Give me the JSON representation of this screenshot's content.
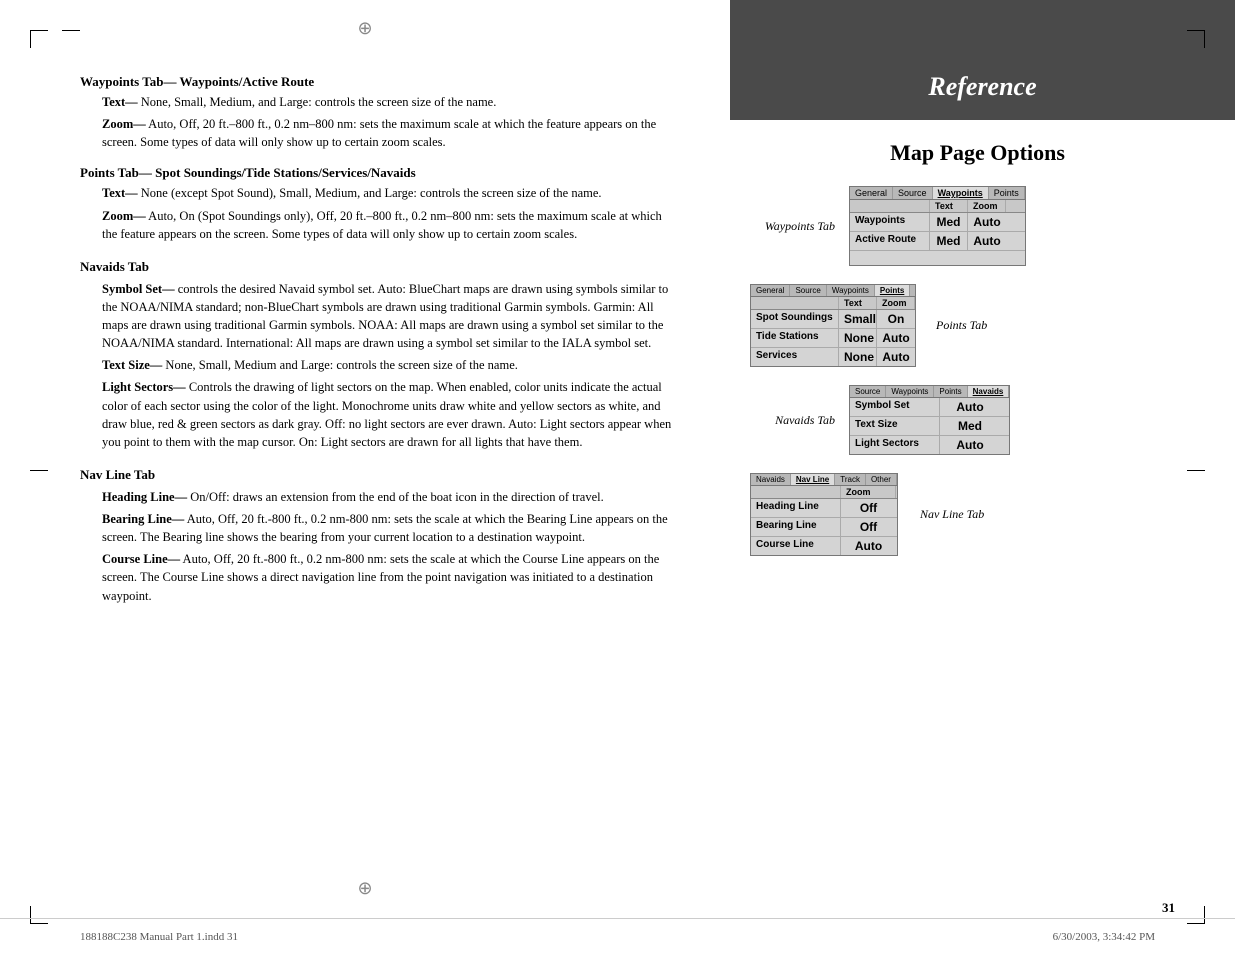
{
  "page": {
    "number": "31",
    "bottom_left": "188188C238 Manual Part 1.indd  31",
    "bottom_right": "6/30/2003, 3:34:42 PM"
  },
  "reference": {
    "header": "Reference",
    "section_title": "Map Page Options"
  },
  "left": {
    "sections": [
      {
        "id": "waypoints-tab",
        "heading_bold": "Waypoints Tab—",
        "heading_rest": " Waypoints/Active Route",
        "items": [
          {
            "label_bold": "Text—",
            "text": " None, Small, Medium, and Large: controls the screen size of the name."
          },
          {
            "label_bold": "Zoom—",
            "text": " Auto, Off, 20 ft.–800 ft., 0.2 nm–800 nm: sets the maximum scale at which the feature appears on the screen. Some types of data will only show up to certain zoom scales."
          }
        ]
      },
      {
        "id": "points-tab",
        "heading_bold": "Points Tab—",
        "heading_rest": " Spot Soundings/Tide Stations/Services/Navaids",
        "items": [
          {
            "label_bold": "Text—",
            "text": " None (except Spot Sound), Small, Medium, and Large: controls the screen size of the name."
          },
          {
            "label_bold": "Zoom—",
            "text": " Auto, On (Spot Soundings only), Off, 20 ft.–800 ft., 0.2 nm–800 nm: sets the maximum scale at which the feature appears on the screen. Some types of data will only show up to certain zoom scales."
          }
        ]
      },
      {
        "id": "navaids-tab",
        "heading": "Navaids Tab",
        "items": [
          {
            "label_bold": "Symbol Set—",
            "text": " controls the desired Navaid symbol set. Auto: BlueChart maps are drawn using symbols similar to the NOAA/NIMA standard; non-BlueChart symbols are drawn using traditional Garmin symbols. Garmin: All maps are drawn using traditional Garmin symbols. NOAA: All maps are drawn using a symbol set similar to the NOAA/NIMA standard. International: All maps are drawn using a symbol set similar to the IALA symbol set."
          },
          {
            "label_bold": "Text Size—",
            "text": " None, Small, Medium and Large: controls the screen size of the name."
          },
          {
            "label_bold": "Light Sectors—",
            "text": " Controls the drawing of light sectors on the map. When enabled, color units indicate the actual color of each sector using the color of the light. Monochrome units draw white and yellow sectors as white, and draw blue, red & green sectors as dark gray. Off: no light sectors are ever drawn. Auto: Light sectors appear when you point to them with the map cursor. On: Light sectors are drawn for all lights that have them."
          }
        ]
      },
      {
        "id": "nav-line-tab",
        "heading": "Nav Line Tab",
        "items": [
          {
            "label_bold": "Heading Line—",
            "text": " On/Off: draws an extension from the end of the boat icon in the direction of travel."
          },
          {
            "label_bold": "Bearing Line—",
            "text": " Auto, Off, 20 ft.-800 ft., 0.2 nm-800 nm: sets the scale at which the Bearing Line appears on the screen. The Bearing line shows the bearing from your current location to a destination waypoint."
          },
          {
            "label_bold": "Course Line—",
            "text": " Auto, Off, 20 ft.-800 ft., 0.2 nm-800 nm: sets the scale at which the Course Line appears on the screen. The Course Line shows a direct navigation line from the point navigation was initiated to a destination waypoint."
          }
        ]
      }
    ]
  },
  "right": {
    "waypoints_tab": {
      "label": "Waypoints Tab",
      "tabs": [
        "General",
        "Source",
        "Waypoints",
        "Points"
      ],
      "active_tab": "Waypoints",
      "col_headers": [
        "",
        "Text",
        "Zoom"
      ],
      "rows": [
        {
          "name": "Waypoints",
          "text": "Med",
          "zoom": "Auto"
        },
        {
          "name": "Active Route",
          "text": "Med",
          "zoom": "Auto"
        }
      ]
    },
    "points_tab": {
      "label": "Points Tab",
      "tabs": [
        "General",
        "Source",
        "Waypoints",
        "Points"
      ],
      "active_tab": "Points",
      "col_headers": [
        "",
        "Text",
        "Zoom"
      ],
      "rows": [
        {
          "name": "Spot Soundings",
          "text": "Small",
          "zoom": "On"
        },
        {
          "name": "Tide Stations",
          "text": "None",
          "zoom": "Auto"
        },
        {
          "name": "Services",
          "text": "None",
          "zoom": "Auto"
        }
      ]
    },
    "navaids_tab": {
      "label": "Navaids Tab",
      "tabs": [
        "Source",
        "Waypoints",
        "Points",
        "Navaids"
      ],
      "active_tab": "Navaids",
      "rows": [
        {
          "name": "Symbol Set",
          "value": "Auto"
        },
        {
          "name": "Text Size",
          "value": "Med"
        },
        {
          "name": "Light Sectors",
          "value": "Auto"
        }
      ]
    },
    "nav_line_tab": {
      "label": "Nav Line Tab",
      "tabs": [
        "Navaids",
        "Nav Line",
        "Track",
        "Other"
      ],
      "active_tab": "Nav Line",
      "col_headers": [
        "",
        "Zoom"
      ],
      "rows": [
        {
          "name": "Heading Line",
          "value": "Off"
        },
        {
          "name": "Bearing Line",
          "value": "Off"
        },
        {
          "name": "Course Line",
          "value": "Auto"
        }
      ]
    }
  }
}
